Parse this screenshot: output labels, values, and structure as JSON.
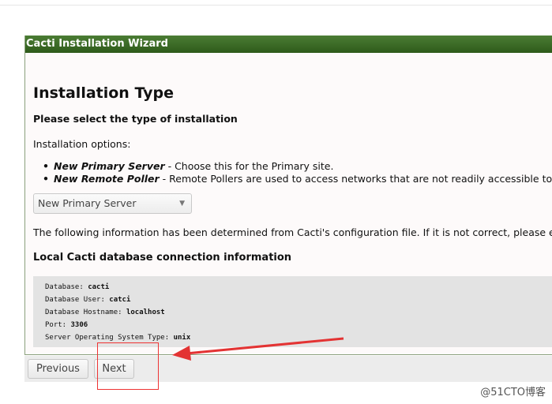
{
  "window": {
    "title": "Cacti Installation Wizard"
  },
  "page": {
    "heading": "Installation Type",
    "subheading": "Please select the type of installation",
    "options_label": "Installation options:",
    "options": [
      {
        "name": "New Primary Server",
        "desc": " - Choose this for the Primary site."
      },
      {
        "name": "New Remote Poller",
        "desc": " - Remote Pollers are used to access networks that are not readily accessible to t"
      }
    ],
    "select_value": "New Primary Server",
    "info_text": "The following information has been determined from Cacti's configuration file. If it is not correct, please edit",
    "db_heading": "Local Cacti database connection information",
    "db": [
      {
        "label": "Database: ",
        "value": "cacti"
      },
      {
        "label": "Database User: ",
        "value": "catci"
      },
      {
        "label": "Database Hostname: ",
        "value": "localhost"
      },
      {
        "label": "Port: ",
        "value": "3306"
      },
      {
        "label": "Server Operating System Type: ",
        "value": "unix"
      }
    ]
  },
  "footer": {
    "previous": "Previous",
    "next": "Next"
  },
  "annotation": {
    "color": "#e33333"
  },
  "watermark": "@51CTO博客"
}
